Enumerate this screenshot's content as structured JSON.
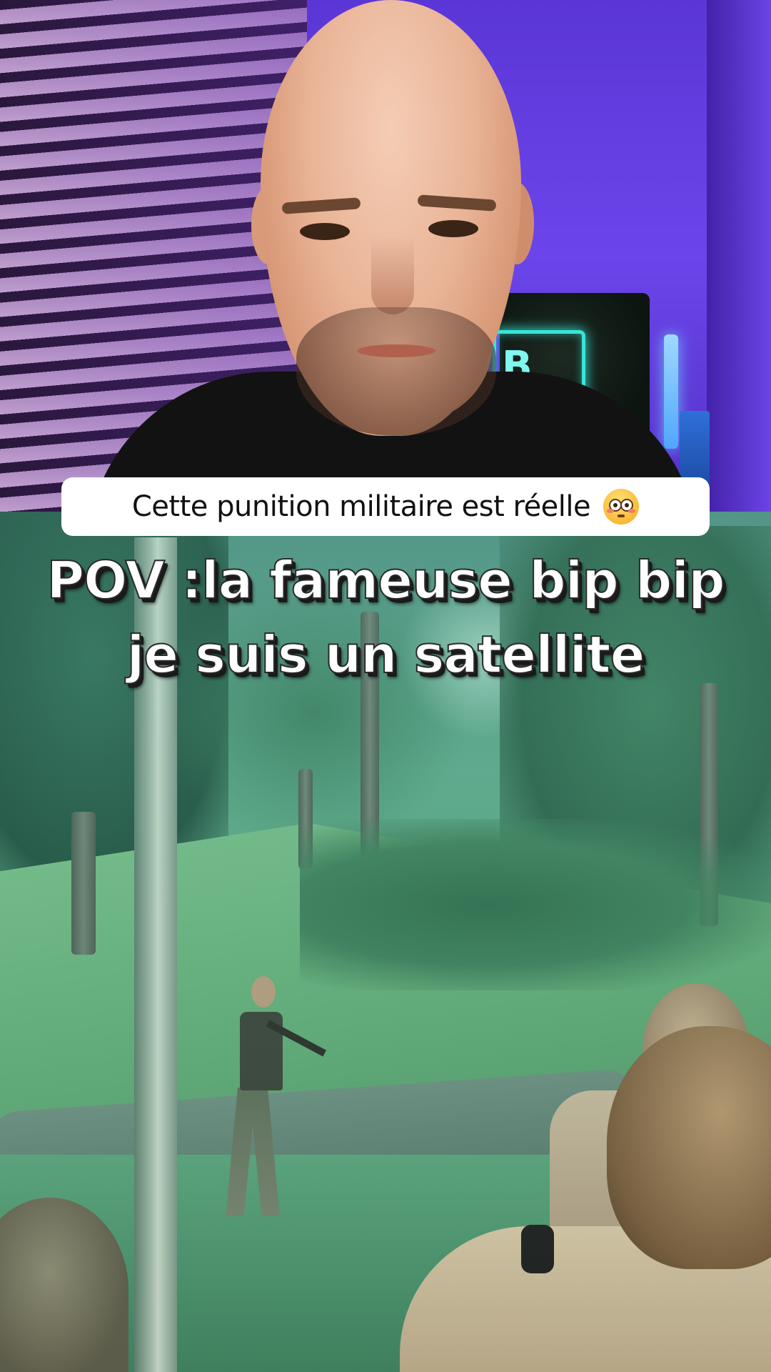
{
  "caption": {
    "text": "Cette punition militaire est réelle",
    "emoji_icon": "flushed-face-icon"
  },
  "video_overlay": {
    "line1": "POV :la fameuse bip bip",
    "line2": "je suis un satellite"
  },
  "neon_sign": {
    "letter": "B"
  },
  "colors": {
    "background_wall": "#6b45ea",
    "neon_accent": "#37e6d8",
    "caption_bg": "#ffffff",
    "caption_text": "#111111",
    "overlay_text": "#ffffff"
  }
}
